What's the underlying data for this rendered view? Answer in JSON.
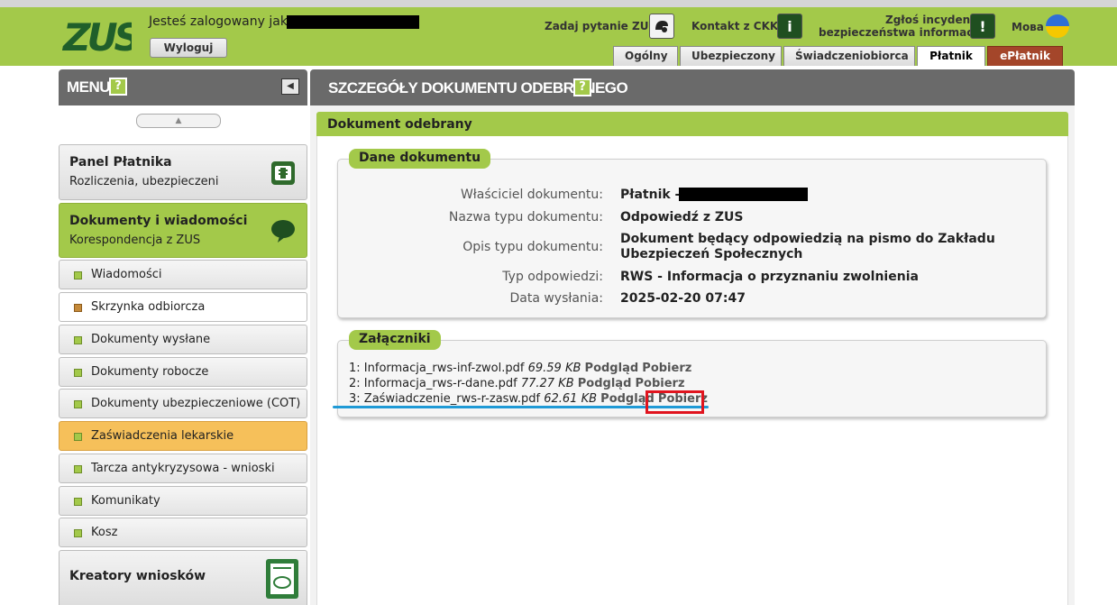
{
  "header": {
    "logo_text": "ZUS",
    "logged_in_label": "Jesteś zalogowany jako:",
    "logout_label": "Wyloguj",
    "ask_label": "Zadaj pytanie ZUS",
    "contact_label": "Kontakt z CKK",
    "incident_line1": "Zgłoś incydent",
    "incident_line2": "bezpieczeństwa informacji",
    "language_label": "Мова",
    "tabs": [
      "Ogólny",
      "Ubezpieczony",
      "Świadczeniobiorca",
      "Płatnik",
      "ePłatnik"
    ],
    "active_tab": "Płatnik",
    "colors": {
      "brand_green": "#a3c94a",
      "dark_green": "#1f4f20",
      "eplatnik_red": "#a4462a"
    }
  },
  "sidebar": {
    "title": "MENU",
    "help_glyph": "?",
    "panels": [
      {
        "title": "Panel Płatnika",
        "subtitle": "Rozliczenia, ubezpieczeni",
        "icon": "payer-panel-icon"
      },
      {
        "title": "Dokumenty i wiadomości",
        "subtitle": "Korespondencja z ZUS",
        "icon": "speech-bubble-icon"
      }
    ],
    "items": [
      {
        "label": "Wiadomości"
      },
      {
        "label": "Skrzynka odbiorcza"
      },
      {
        "label": "Dokumenty wysłane"
      },
      {
        "label": "Dokumenty robocze"
      },
      {
        "label": "Dokumenty ubezpieczeniowe (COT)"
      },
      {
        "label": "Zaświadczenia lekarskie"
      },
      {
        "label": "Tarcza antykryzysowa - wnioski"
      },
      {
        "label": "Komunikaty"
      },
      {
        "label": "Kosz"
      }
    ],
    "selected_item": "Skrzynka odbiorcza",
    "highlighted_item": "Zaświadczenia lekarskie",
    "bottom_panel": {
      "title": "Kreatory wniosków",
      "icon": "form-creator-icon"
    }
  },
  "main": {
    "title": "SZCZEGÓŁY DOKUMENTU ODEBRANEGO",
    "help_glyph": "?",
    "section_title": "Dokument odebrany",
    "details_legend": "Dane dokumentu",
    "details": [
      {
        "label": "Właściciel dokumentu:",
        "value": "Płatnik -"
      },
      {
        "label": "Nazwa typu dokumentu:",
        "value": "Odpowiedź z ZUS"
      },
      {
        "label": "Opis typu dokumentu:",
        "value": "Dokument będący odpowiedzią na pismo do Zakładu",
        "value2": "Ubezpieczeń Społecznych"
      },
      {
        "label": "Typ odpowiedzi:",
        "value": "RWS - Informacja o przyznaniu zwolnienia"
      },
      {
        "label": "Data wysłania:",
        "value": "2025-02-20 07:47"
      }
    ],
    "attachments_legend": "Załączniki",
    "attachments": [
      {
        "index": "1:",
        "name": "Informacja_rws-inf-zwol.pdf",
        "size": "69.59 KB",
        "preview": "Podgląd",
        "download": "Pobierz"
      },
      {
        "index": "2:",
        "name": "Informacja_rws-r-dane.pdf",
        "size": "77.27 KB",
        "preview": "Podgląd",
        "download": "Pobierz"
      },
      {
        "index": "3:",
        "name": "Zaświadczenie_rws-r-zasw.pdf",
        "size": "62.61 KB",
        "preview": "Podgląd",
        "download": "Pobierz"
      }
    ]
  }
}
